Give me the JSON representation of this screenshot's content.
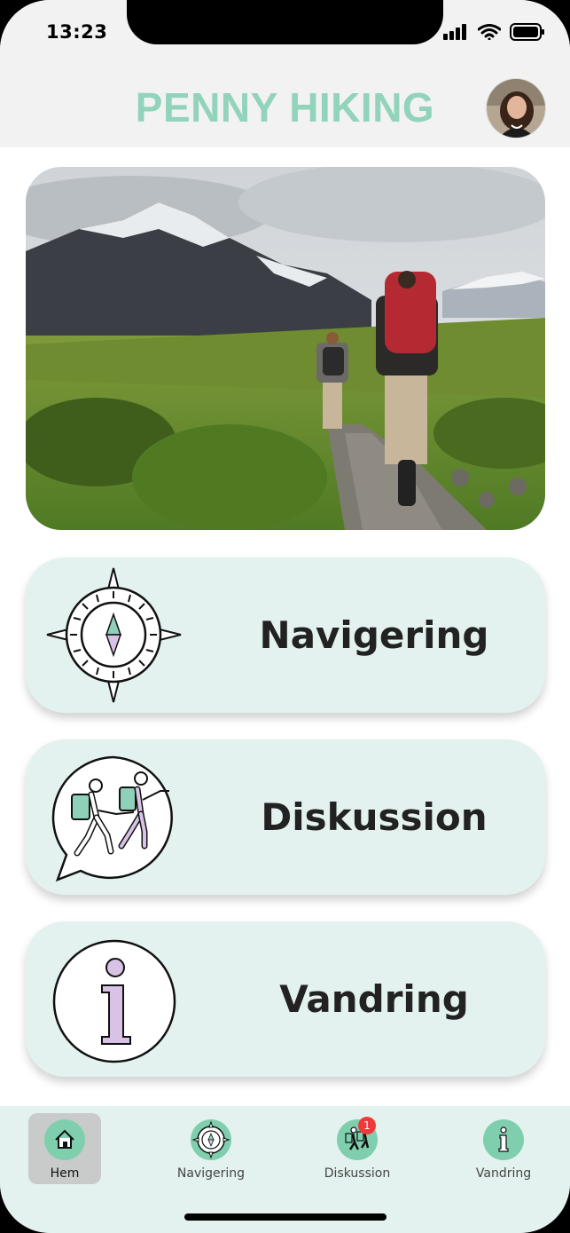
{
  "status_bar": {
    "time": "13:23",
    "icons": [
      "signal-icon",
      "wifi-icon",
      "battery-icon"
    ]
  },
  "header": {
    "title": "PENNY HIKING",
    "title_color": "#92d3bb",
    "avatar": "user-avatar"
  },
  "hero": {
    "image": "hikers-mountain-trail-photo"
  },
  "cards": [
    {
      "label": "Navigering",
      "icon": "compass-icon"
    },
    {
      "label": "Diskussion",
      "icon": "hikers-chat-icon"
    },
    {
      "label": "Vandring",
      "icon": "info-icon"
    }
  ],
  "tabbar": {
    "tabs": [
      {
        "label": "Hem",
        "icon": "home-icon",
        "active": true
      },
      {
        "label": "Navigering",
        "icon": "compass-icon",
        "active": false
      },
      {
        "label": "Diskussion",
        "icon": "hikers-icon",
        "active": false,
        "badge": "1"
      },
      {
        "label": "Vandring",
        "icon": "info-icon",
        "active": false
      }
    ]
  },
  "colors": {
    "accent": "#92d3bb",
    "card_bg": "#e3f2ee",
    "badge": "#f0393a",
    "lilac": "#d8c3e6"
  }
}
